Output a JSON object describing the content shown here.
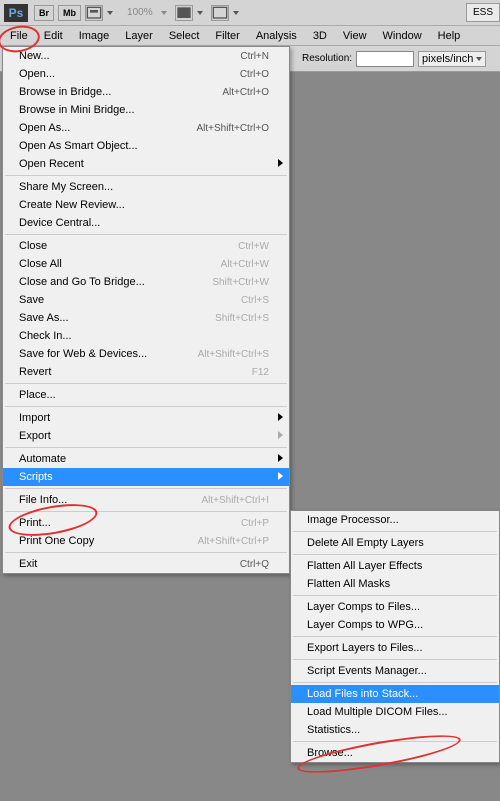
{
  "toolbar": {
    "logo": "Ps",
    "br": "Br",
    "mb": "Mb",
    "zoom": "100%",
    "ess": "ESS"
  },
  "menubar": [
    "File",
    "Edit",
    "Image",
    "Layer",
    "Select",
    "Filter",
    "Analysis",
    "3D",
    "View",
    "Window",
    "Help"
  ],
  "options": {
    "res_label": "Resolution:",
    "res_value": "",
    "unit": "pixels/inch"
  },
  "file_menu": [
    {
      "t": "item",
      "label": "New...",
      "sc": "Ctrl+N"
    },
    {
      "t": "item",
      "label": "Open...",
      "sc": "Ctrl+O"
    },
    {
      "t": "item",
      "label": "Browse in Bridge...",
      "sc": "Alt+Ctrl+O"
    },
    {
      "t": "item",
      "label": "Browse in Mini Bridge..."
    },
    {
      "t": "item",
      "label": "Open As...",
      "sc": "Alt+Shift+Ctrl+O"
    },
    {
      "t": "item",
      "label": "Open As Smart Object..."
    },
    {
      "t": "item",
      "label": "Open Recent",
      "sub": true
    },
    {
      "t": "sep"
    },
    {
      "t": "item",
      "label": "Share My Screen..."
    },
    {
      "t": "item",
      "label": "Create New Review..."
    },
    {
      "t": "item",
      "label": "Device Central..."
    },
    {
      "t": "sep"
    },
    {
      "t": "item",
      "dis": true,
      "label": "Close",
      "sc": "Ctrl+W"
    },
    {
      "t": "item",
      "dis": true,
      "label": "Close All",
      "sc": "Alt+Ctrl+W"
    },
    {
      "t": "item",
      "dis": true,
      "label": "Close and Go To Bridge...",
      "sc": "Shift+Ctrl+W"
    },
    {
      "t": "item",
      "dis": true,
      "label": "Save",
      "sc": "Ctrl+S"
    },
    {
      "t": "item",
      "dis": true,
      "label": "Save As...",
      "sc": "Shift+Ctrl+S"
    },
    {
      "t": "item",
      "dis": true,
      "label": "Check In..."
    },
    {
      "t": "item",
      "dis": true,
      "label": "Save for Web & Devices...",
      "sc": "Alt+Shift+Ctrl+S"
    },
    {
      "t": "item",
      "dis": true,
      "label": "Revert",
      "sc": "F12"
    },
    {
      "t": "sep"
    },
    {
      "t": "item",
      "dis": true,
      "label": "Place..."
    },
    {
      "t": "sep"
    },
    {
      "t": "item",
      "label": "Import",
      "sub": true
    },
    {
      "t": "item",
      "dis": true,
      "label": "Export",
      "sub": true
    },
    {
      "t": "sep"
    },
    {
      "t": "item",
      "label": "Automate",
      "sub": true
    },
    {
      "t": "item",
      "label": "Scripts",
      "sub": true,
      "hl": true
    },
    {
      "t": "sep"
    },
    {
      "t": "item",
      "dis": true,
      "label": "File Info...",
      "sc": "Alt+Shift+Ctrl+I"
    },
    {
      "t": "sep"
    },
    {
      "t": "item",
      "dis": true,
      "label": "Print...",
      "sc": "Ctrl+P"
    },
    {
      "t": "item",
      "dis": true,
      "label": "Print One Copy",
      "sc": "Alt+Shift+Ctrl+P"
    },
    {
      "t": "sep"
    },
    {
      "t": "item",
      "label": "Exit",
      "sc": "Ctrl+Q"
    }
  ],
  "scripts_menu": [
    {
      "t": "item",
      "label": "Image Processor..."
    },
    {
      "t": "sep"
    },
    {
      "t": "item",
      "label": "Delete All Empty Layers"
    },
    {
      "t": "sep"
    },
    {
      "t": "item",
      "label": "Flatten All Layer Effects"
    },
    {
      "t": "item",
      "label": "Flatten All Masks"
    },
    {
      "t": "sep"
    },
    {
      "t": "item",
      "label": "Layer Comps to Files..."
    },
    {
      "t": "item",
      "label": "Layer Comps to WPG..."
    },
    {
      "t": "sep"
    },
    {
      "t": "item",
      "label": "Export Layers to Files..."
    },
    {
      "t": "sep"
    },
    {
      "t": "item",
      "label": "Script Events Manager..."
    },
    {
      "t": "sep"
    },
    {
      "t": "item",
      "label": "Load Files into Stack...",
      "hl": true
    },
    {
      "t": "item",
      "label": "Load Multiple DICOM Files..."
    },
    {
      "t": "item",
      "label": "Statistics..."
    },
    {
      "t": "sep"
    },
    {
      "t": "item",
      "label": "Browse..."
    }
  ]
}
